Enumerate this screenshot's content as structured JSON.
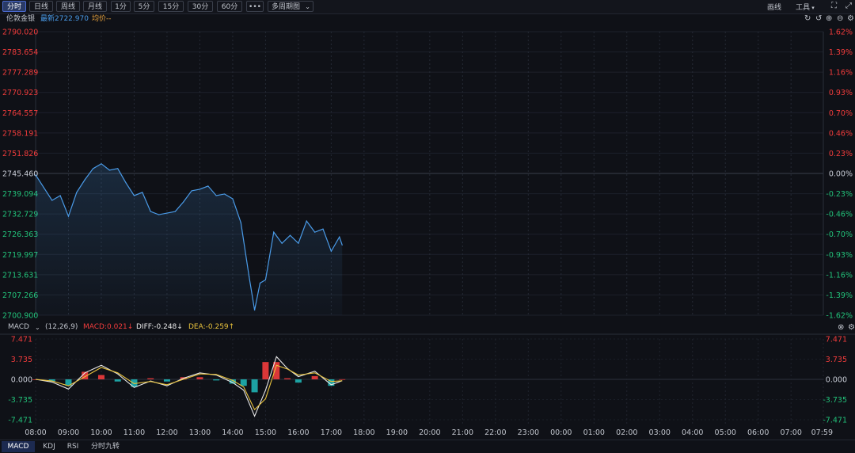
{
  "toolbar": {
    "periods": [
      "分时",
      "日线",
      "周线",
      "月线",
      "1分",
      "5分",
      "15分",
      "30分",
      "60分"
    ],
    "more": "•••",
    "multi_period": "多周期图",
    "draw": "画线",
    "tools": "工具"
  },
  "info": {
    "name": "伦敦金银",
    "latest": "最新2722.970",
    "avg": "均价--"
  },
  "price_axis": {
    "left": [
      "2790.020",
      "2783.654",
      "2777.289",
      "2770.923",
      "2764.557",
      "2758.191",
      "2751.826",
      "2745.460",
      "2739.094",
      "2732.729",
      "2726.363",
      "2719.997",
      "2713.631",
      "2707.266",
      "2700.900"
    ],
    "right": [
      "1.62%",
      "1.39%",
      "1.16%",
      "0.93%",
      "0.70%",
      "0.46%",
      "0.23%",
      "0.00%",
      "-0.23%",
      "-0.46%",
      "-0.70%",
      "-0.93%",
      "-1.16%",
      "-1.39%",
      "-1.62%"
    ]
  },
  "macd": {
    "name": "MACD",
    "params": "(12,26,9)",
    "macd": "MACD:0.021↓",
    "diff": "DIFF:-0.248↓",
    "dea": "DEA:-0.259↑",
    "axis": [
      "7.471",
      "3.735",
      "0.000",
      "-3.735",
      "-7.471"
    ]
  },
  "time_axis": [
    "08:00",
    "09:00",
    "10:00",
    "11:00",
    "12:00",
    "13:00",
    "14:00",
    "15:00",
    "16:00",
    "17:00",
    "18:00",
    "19:00",
    "20:00",
    "21:00",
    "22:00",
    "23:00",
    "00:00",
    "01:00",
    "02:00",
    "03:00",
    "04:00",
    "05:00",
    "06:00",
    "07:00",
    "07:59"
  ],
  "bottom_tabs": [
    "MACD",
    "KDJ",
    "RSI",
    "分时九转"
  ],
  "colors": {
    "up": "#f23c3c",
    "down": "#22c27a",
    "neutral": "#c8ccd6",
    "price_line": "#4a9be8",
    "diff": "#e8e8e8",
    "dea": "#e8c23c",
    "macd_up": "#f23c3c",
    "macd_down": "#1fb3b3"
  },
  "chart_data": [
    {
      "type": "line",
      "title": "伦敦金银 分时",
      "x_range": [
        "08:00",
        "07:59"
      ],
      "ylim": [
        2700.9,
        2790.02
      ],
      "baseline": 2745.46,
      "x": [
        "08:00",
        "08:15",
        "08:30",
        "08:45",
        "09:00",
        "09:15",
        "09:30",
        "09:45",
        "10:00",
        "10:15",
        "10:30",
        "10:45",
        "11:00",
        "11:15",
        "11:30",
        "11:45",
        "12:00",
        "12:15",
        "12:30",
        "12:45",
        "13:00",
        "13:15",
        "13:30",
        "13:45",
        "14:00",
        "14:15",
        "14:30",
        "14:40",
        "14:50",
        "15:00",
        "15:15",
        "15:30",
        "15:45",
        "16:00",
        "16:15",
        "16:30",
        "16:45",
        "17:00",
        "17:15",
        "17:20"
      ],
      "values": [
        2745.0,
        2741.0,
        2737.0,
        2738.5,
        2732.0,
        2739.5,
        2743.5,
        2747.0,
        2748.5,
        2746.5,
        2747.0,
        2742.5,
        2738.5,
        2739.5,
        2733.5,
        2732.5,
        2733.0,
        2733.5,
        2736.5,
        2740.0,
        2740.5,
        2741.5,
        2738.5,
        2739.0,
        2737.5,
        2730.0,
        2713.0,
        2702.5,
        2711.0,
        2712.0,
        2727.0,
        2723.5,
        2726.0,
        2723.5,
        2730.5,
        2727.0,
        2728.0,
        2721.0,
        2725.5,
        2722.97
      ]
    },
    {
      "type": "line",
      "title": "MACD",
      "ylim": [
        -7.471,
        7.471
      ],
      "x": [
        "08:00",
        "08:30",
        "09:00",
        "09:30",
        "10:00",
        "10:30",
        "11:00",
        "11:30",
        "12:00",
        "12:30",
        "13:00",
        "13:30",
        "14:00",
        "14:20",
        "14:40",
        "15:00",
        "15:20",
        "15:40",
        "16:00",
        "16:30",
        "17:00",
        "17:20"
      ],
      "series": [
        {
          "name": "DIFF",
          "values": [
            0.0,
            -0.5,
            -1.8,
            1.2,
            2.6,
            1.0,
            -1.5,
            -0.3,
            -1.2,
            0.2,
            1.2,
            0.8,
            -0.6,
            -2.0,
            -6.8,
            -2.0,
            4.2,
            2.0,
            0.5,
            1.5,
            -1.0,
            -0.248
          ]
        },
        {
          "name": "DEA",
          "values": [
            0.0,
            -0.3,
            -1.2,
            0.5,
            2.2,
            1.2,
            -0.8,
            -0.4,
            -1.0,
            0.0,
            1.0,
            0.9,
            -0.2,
            -1.4,
            -5.6,
            -3.6,
            2.6,
            1.9,
            0.8,
            1.2,
            -0.4,
            -0.259
          ]
        },
        {
          "name": "MACD",
          "values": [
            0.0,
            -0.4,
            -1.2,
            1.4,
            0.8,
            -0.4,
            -1.4,
            0.2,
            -0.4,
            0.4,
            0.4,
            -0.2,
            -0.8,
            -1.2,
            -2.4,
            3.2,
            3.2,
            0.2,
            -0.6,
            0.6,
            -1.2,
            0.021
          ]
        }
      ]
    }
  ]
}
